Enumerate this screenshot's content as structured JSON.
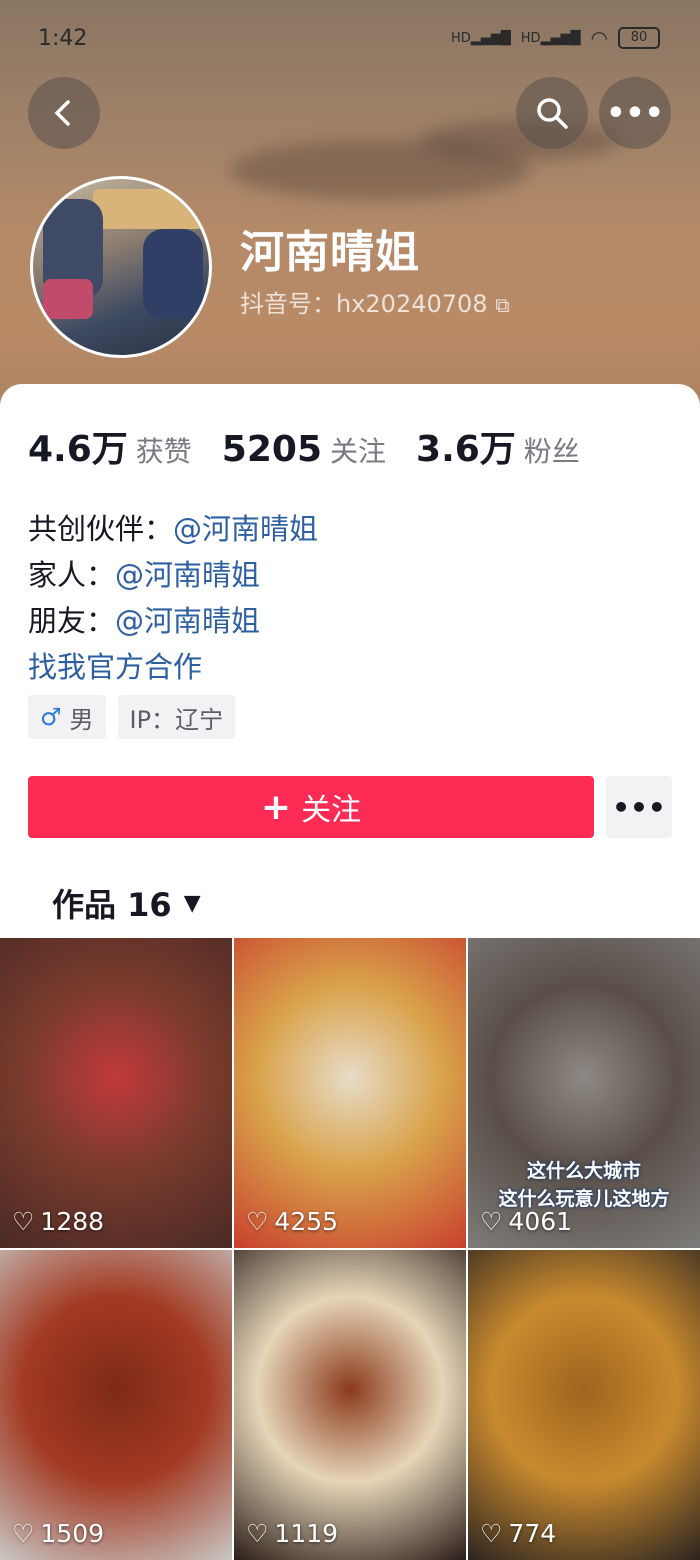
{
  "status_bar": {
    "time": "1:42",
    "network1": "HD",
    "network2": "HD",
    "battery": "80"
  },
  "header": {
    "name": "河南晴姐",
    "douyin_id": "抖音号：hx20240708"
  },
  "stats": [
    {
      "value": "4.6万",
      "label": "获赞"
    },
    {
      "value": "5205",
      "label": "关注"
    },
    {
      "value": "3.6万",
      "label": "粉丝"
    }
  ],
  "bio": {
    "partner_label": "共创伙伴：",
    "partner_link": "@河南晴姐",
    "family_label": "家人：",
    "family_link": "@河南晴姐",
    "friend_label": "朋友：",
    "friend_link": "@河南晴姐",
    "cooperation": "找我官方合作"
  },
  "tags": {
    "gender": "男",
    "ip": "IP：辽宁"
  },
  "actions": {
    "follow_label": "关注"
  },
  "works_tab": {
    "label": "作品 16"
  },
  "videos": [
    {
      "likes": "1288",
      "colors": [
        "#4a2a24",
        "#7a3b2e",
        "#c23a3a"
      ]
    },
    {
      "likes": "4255",
      "colors": [
        "#c8402e",
        "#d9a24a",
        "#e7dcc8"
      ]
    },
    {
      "likes": "4061",
      "colors": [
        "#7d7c7a",
        "#5a4f48",
        "#8e8984"
      ],
      "caption1": "这什么大城市",
      "caption2": "这什么玩意儿这地方"
    },
    {
      "likes": "1509",
      "colors": [
        "#c8c7c5",
        "#a33a22",
        "#7e2a18"
      ]
    },
    {
      "likes": "1119",
      "colors": [
        "#2a1d18",
        "#e6d5b8",
        "#8b3a1c"
      ]
    },
    {
      "likes": "774",
      "colors": [
        "#2b2420",
        "#c98a2e",
        "#a0641e"
      ]
    }
  ]
}
